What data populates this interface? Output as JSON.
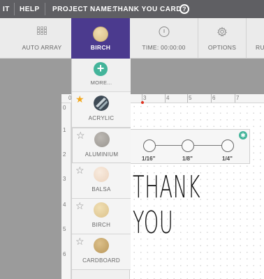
{
  "menubar": {
    "items": [
      "IT",
      "HELP",
      "PROJECT NAME:",
      "THANK YOU CARD"
    ],
    "help_symbol": "?"
  },
  "toolbar": {
    "tools": [
      {
        "label": "AUTO ARRAY",
        "icon": "grid-icon"
      },
      {
        "label": "BIRCH",
        "icon": "birch-swatch",
        "active": true
      },
      {
        "label": "TIME: 00:00:00",
        "icon": "clock-icon"
      },
      {
        "label": "OPTIONS",
        "icon": "gear-icon"
      },
      {
        "label": "RU",
        "icon": ""
      }
    ]
  },
  "dropdown": {
    "more_label": "MORE...",
    "materials": [
      {
        "label": "ACRYLIC",
        "favorite": true,
        "color": "#3e4a55"
      },
      {
        "label": "ALUMINIUM",
        "favorite": false,
        "color": "#a9a6a2"
      },
      {
        "label": "BALSA",
        "favorite": false,
        "color": "#f3dfcd"
      },
      {
        "label": "BIRCH",
        "favorite": false,
        "color": "#e6cf9c"
      },
      {
        "label": "CARDBOARD",
        "favorite": false,
        "color": "#c9a869"
      }
    ]
  },
  "thickness": {
    "options": [
      "1/16\"",
      "1/8\"",
      "1/4\""
    ]
  },
  "ruler": {
    "top": [
      "0",
      "3",
      "4",
      "5",
      "6",
      "7"
    ],
    "left": [
      "0",
      "1",
      "2",
      "3",
      "4",
      "5",
      "6"
    ]
  },
  "canvas": {
    "text": "THANK YOU"
  },
  "colors": {
    "accent": "#4b3a8e",
    "teal": "#43b49a",
    "favorite_star": "#f2a71b"
  }
}
